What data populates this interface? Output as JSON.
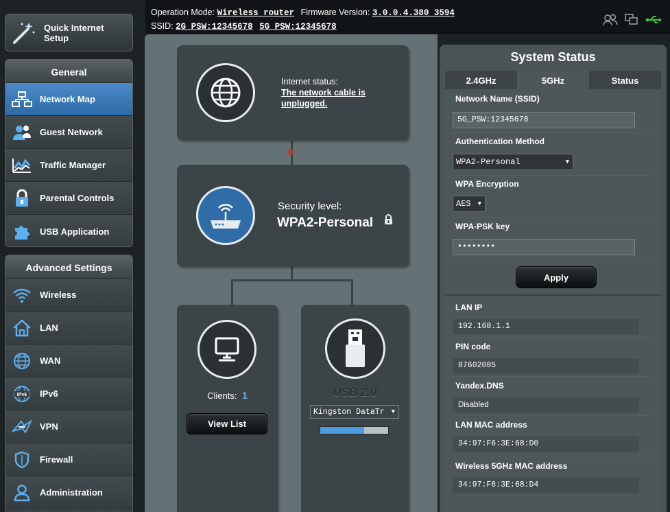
{
  "header": {
    "op_mode_label": "Operation Mode:",
    "op_mode_value": "Wireless router",
    "fw_label": "Firmware Version:",
    "fw_value": "3.0.0.4.380_3594",
    "ssid_label": "SSID:",
    "ssid_2g": "2G_PSW:12345678",
    "ssid_5g": "5G_PSW:12345678"
  },
  "sidebar": {
    "quick_setup": "Quick Internet Setup",
    "general_title": "General",
    "general_items": [
      {
        "label": "Network Map",
        "icon": "network-map-icon"
      },
      {
        "label": "Guest Network",
        "icon": "guest-network-icon"
      },
      {
        "label": "Traffic Manager",
        "icon": "traffic-manager-icon"
      },
      {
        "label": "Parental Controls",
        "icon": "lock-icon"
      },
      {
        "label": "USB Application",
        "icon": "puzzle-icon"
      }
    ],
    "advanced_title": "Advanced Settings",
    "advanced_items": [
      {
        "label": "Wireless",
        "icon": "wifi-icon"
      },
      {
        "label": "LAN",
        "icon": "home-icon"
      },
      {
        "label": "WAN",
        "icon": "globe-icon"
      },
      {
        "label": "IPv6",
        "icon": "ipv6-icon"
      },
      {
        "label": "VPN",
        "icon": "vpn-icon"
      },
      {
        "label": "Firewall",
        "icon": "shield-icon"
      },
      {
        "label": "Administration",
        "icon": "user-icon"
      }
    ]
  },
  "map": {
    "internet_status_label": "Internet status:",
    "internet_status_value": "The network cable is unplugged.",
    "security_label": "Security level:",
    "security_value": "WPA2-Personal",
    "clients_label": "Clients:",
    "clients_count": "1",
    "view_list": "View List",
    "usb_label": "USB 2.0",
    "usb_device": "Kingston DataTr",
    "usb_usage_fraction": 0.65
  },
  "status": {
    "title": "System Status",
    "tabs": [
      "2.4GHz",
      "5GHz",
      "Status"
    ],
    "selected_tab": "5GHz",
    "ssid_label": "Network Name (SSID)",
    "ssid_value": "5G_PSW:12345678",
    "auth_label": "Authentication Method",
    "auth_value": "WPA2-Personal",
    "enc_label": "WPA Encryption",
    "enc_value": "AES",
    "psk_label": "WPA-PSK key",
    "psk_value": "••••••••",
    "apply": "Apply",
    "lan_ip_label": "LAN IP",
    "lan_ip_value": "192.168.1.1",
    "pin_label": "PIN code",
    "pin_value": "87602005",
    "dns_label": "Yandex.DNS",
    "dns_value": "Disabled",
    "lan_mac_label": "LAN MAC address",
    "lan_mac_value": "34:97:F6:3E:68:D0",
    "wmac_label": "Wireless 5GHz MAC address",
    "wmac_value": "34:97:F6:3E:68:D4"
  },
  "colors": {
    "accent": "#2c6aa8",
    "panel": "#3b4447",
    "bg": "#657275",
    "error": "#c0392b",
    "clients_count": "#6fb3e8"
  }
}
